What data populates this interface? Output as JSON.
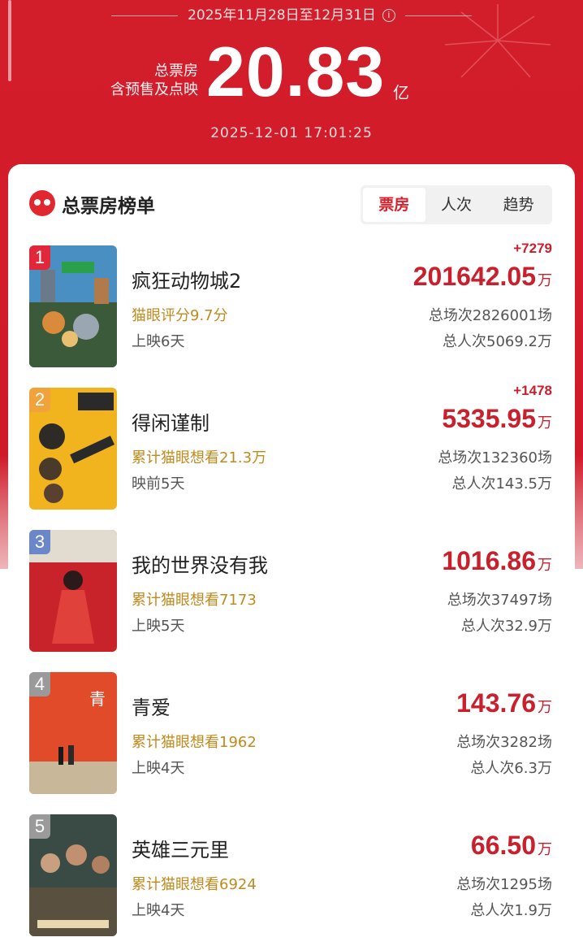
{
  "header": {
    "date_range": "2025年11月28日至12月31日",
    "info_icon": "info-icon",
    "total_label_line1": "总票房",
    "total_label_line2": "含预售及点映",
    "total_value": "20.83",
    "total_unit": "亿",
    "timestamp": "2025-12-01  17:01:25"
  },
  "board": {
    "title": "总票房榜单",
    "logo_icon": "maoyan-cat-icon",
    "tabs": [
      "票房",
      "人次",
      "趋势"
    ],
    "active_tab": "票房"
  },
  "movies": [
    {
      "rank": "1",
      "title": "疯狂动物城2",
      "sub1": "猫眼评分9.7分",
      "sub2": "上映6天",
      "delta": "+7279",
      "gross": "201642.05",
      "unit": "万",
      "shows": "总场次2826001场",
      "people": "总人次5069.2万"
    },
    {
      "rank": "2",
      "title": "得闲谨制",
      "sub1": "累计猫眼想看21.3万",
      "sub2": "映前5天",
      "delta": "+1478",
      "gross": "5335.95",
      "unit": "万",
      "shows": "总场次132360场",
      "people": "总人次143.5万"
    },
    {
      "rank": "3",
      "title": "我的世界没有我",
      "sub1": "累计猫眼想看7173",
      "sub2": "上映5天",
      "delta": "",
      "gross": "1016.86",
      "unit": "万",
      "shows": "总场次37497场",
      "people": "总人次32.9万"
    },
    {
      "rank": "4",
      "title": "青爱",
      "sub1": "累计猫眼想看1962",
      "sub2": "上映4天",
      "delta": "",
      "gross": "143.76",
      "unit": "万",
      "shows": "总场次3282场",
      "people": "总人次6.3万"
    },
    {
      "rank": "5",
      "title": "英雄三元里",
      "sub1": "累计猫眼想看6924",
      "sub2": "上映4天",
      "delta": "",
      "gross": "66.50",
      "unit": "万",
      "shows": "总场次1295场",
      "people": "总人次1.9万"
    }
  ],
  "colors": {
    "brand_red": "#d8232f",
    "gold": "#c08a1e",
    "rank1": "#e0283a",
    "rank2": "#f2a23a",
    "rank3": "#6b86c9",
    "rank_other": "#9a9a9a"
  }
}
